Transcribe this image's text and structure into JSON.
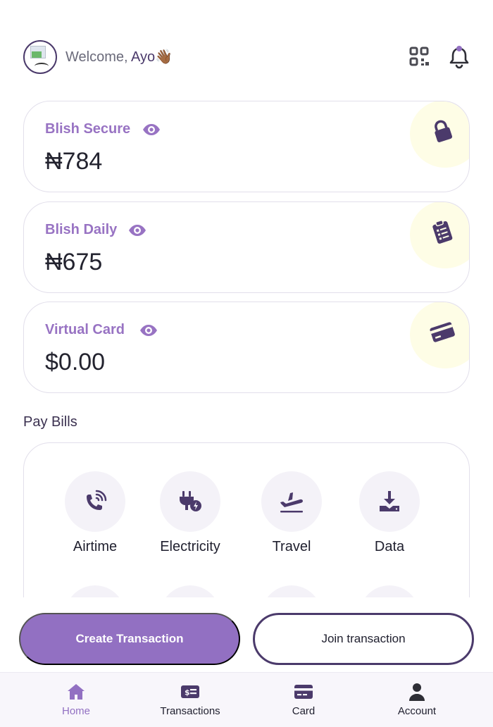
{
  "header": {
    "welcome_prefix": "Welcome, ",
    "user_name": "Ayo👋🏾",
    "icons": [
      "qr-code-icon",
      "bell-icon"
    ]
  },
  "cards": [
    {
      "label": "Blish Secure",
      "amount": "₦784",
      "icon": "lock-icon"
    },
    {
      "label": "Blish Daily",
      "amount": "₦675",
      "icon": "clipboard-icon"
    },
    {
      "label": "Virtual Card",
      "amount": "$0.00",
      "icon": "credit-card-icon"
    }
  ],
  "pay_bills": {
    "title": "Pay Bills",
    "items": [
      {
        "label": "Airtime",
        "icon": "phone-icon"
      },
      {
        "label": "Electricity",
        "icon": "plug-icon"
      },
      {
        "label": "Travel",
        "icon": "airplane-icon"
      },
      {
        "label": "Data",
        "icon": "download-icon"
      }
    ]
  },
  "actions": {
    "create": "Create Transaction",
    "join": "Join transaction"
  },
  "nav": {
    "items": [
      {
        "label": "Home",
        "icon": "home-icon",
        "active": true
      },
      {
        "label": "Transactions",
        "icon": "money-icon",
        "active": false
      },
      {
        "label": "Card",
        "icon": "card-icon",
        "active": false
      },
      {
        "label": "Account",
        "icon": "user-icon",
        "active": false
      }
    ]
  },
  "colors": {
    "accent": "#9270c2",
    "accent_label": "#9873c3",
    "dark_purple": "#4b3a6b",
    "badge_bg": "#fefde6"
  }
}
